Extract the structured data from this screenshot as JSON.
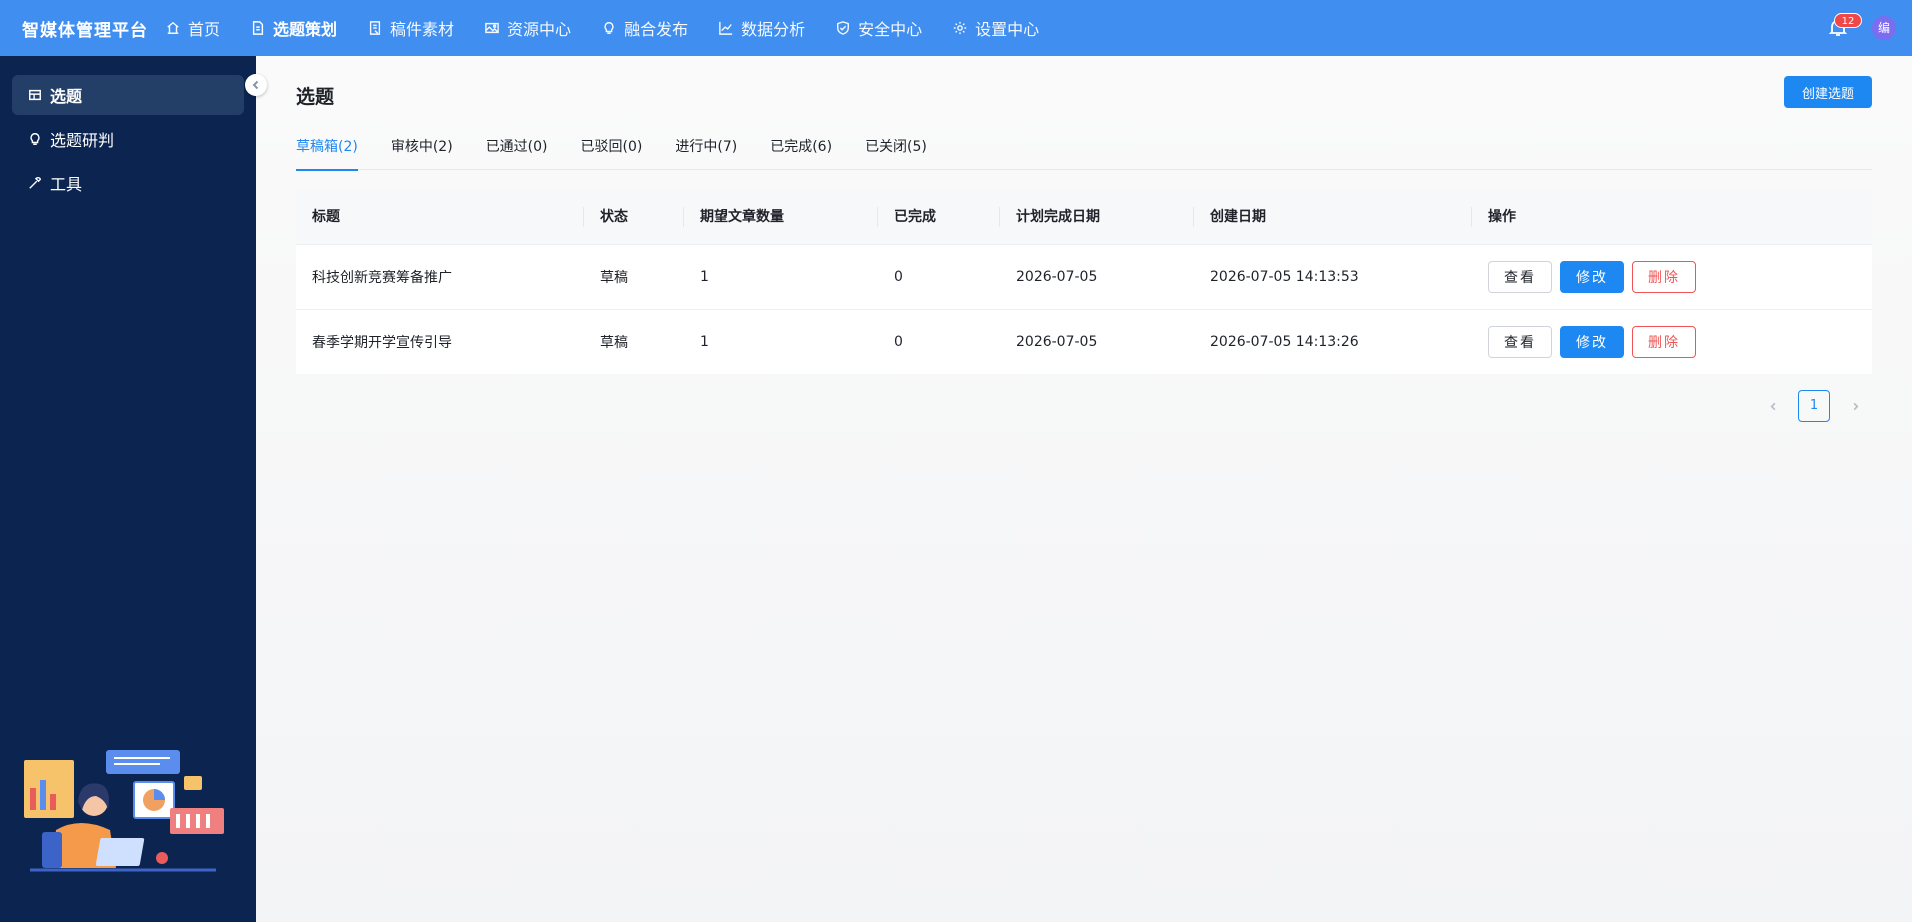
{
  "app": {
    "brand": "智媒体管理平台"
  },
  "nav": [
    {
      "label": "首页",
      "icon": "home-icon"
    },
    {
      "label": "选题策划",
      "icon": "document-icon",
      "active": true
    },
    {
      "label": "稿件素材",
      "icon": "manuscript-icon"
    },
    {
      "label": "资源中心",
      "icon": "image-icon"
    },
    {
      "label": "融合发布",
      "icon": "bulb-icon"
    },
    {
      "label": "数据分析",
      "icon": "chart-icon"
    },
    {
      "label": "安全中心",
      "icon": "shield-icon"
    },
    {
      "label": "设置中心",
      "icon": "gear-icon"
    }
  ],
  "header": {
    "notification_count": "12",
    "avatar_text": "编"
  },
  "sidebar": {
    "items": [
      {
        "label": "选题",
        "icon": "grid-icon",
        "active": true
      },
      {
        "label": "选题研判",
        "icon": "bulb-icon"
      },
      {
        "label": "工具",
        "icon": "wrench-icon"
      }
    ]
  },
  "page": {
    "title": "选题",
    "create_button": "创建选题"
  },
  "tabs": [
    {
      "label": "草稿箱(2)",
      "active": true
    },
    {
      "label": "审核中(2)"
    },
    {
      "label": "已通过(0)"
    },
    {
      "label": "已驳回(0)"
    },
    {
      "label": "进行中(7)"
    },
    {
      "label": "已完成(6)"
    },
    {
      "label": "已关闭(5)"
    }
  ],
  "table": {
    "columns": [
      "标题",
      "状态",
      "期望文章数量",
      "已完成",
      "计划完成日期",
      "创建日期",
      "操作"
    ],
    "rows": [
      {
        "title": "科技创新竞赛筹备推广",
        "status": "草稿",
        "expected": "1",
        "done": "0",
        "plan_date": "2026-07-05",
        "created": "2026-07-05 14:13:53"
      },
      {
        "title": "春季学期开学宣传引导",
        "status": "草稿",
        "expected": "1",
        "done": "0",
        "plan_date": "2026-07-05",
        "created": "2026-07-05 14:13:26"
      }
    ],
    "actions": {
      "view": "查看",
      "edit": "修改",
      "delete": "删除"
    }
  },
  "pagination": {
    "current": "1"
  },
  "colors": {
    "topbar": "#3f8ef0",
    "sidebar": "#0c2450",
    "primary": "#1e88f2",
    "danger": "#f05454"
  }
}
